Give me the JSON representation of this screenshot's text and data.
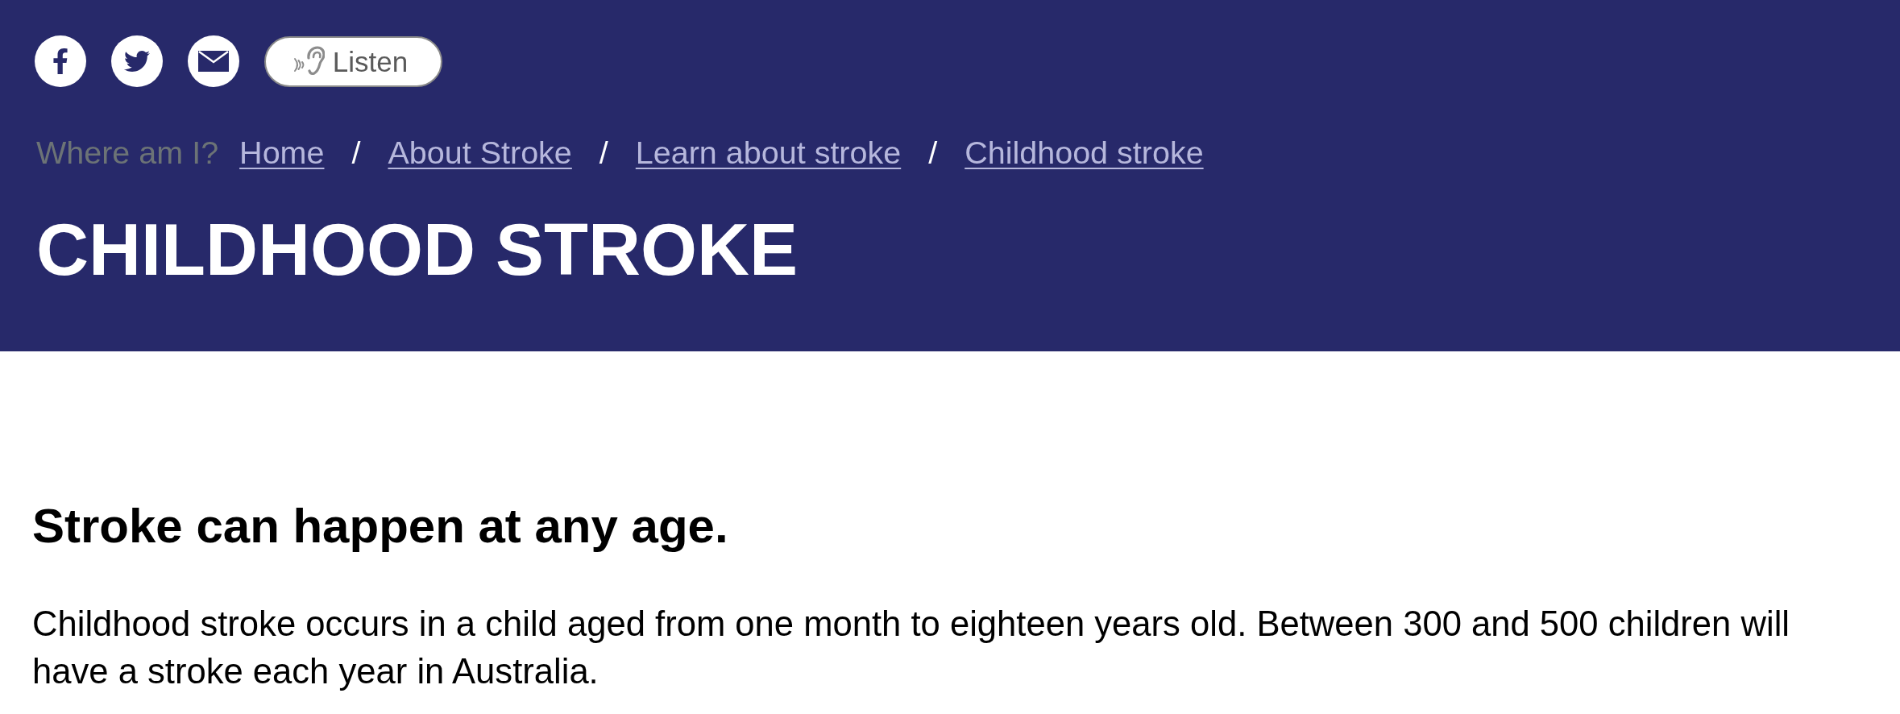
{
  "toolbar": {
    "listen_button": {
      "label": "Listen"
    }
  },
  "breadcrumb": {
    "label": "Where am I?",
    "items": [
      {
        "text": "Home"
      },
      {
        "separator": "/",
        "text": "About Stroke"
      },
      {
        "separator": "/",
        "text": "Learn about stroke"
      },
      {
        "separator": "/",
        "text": "Childhood stroke"
      }
    ]
  },
  "page_title": "CHILDHOOD STROKE",
  "content": {
    "heading": "Stroke can happen at any age.",
    "paragraph": "Childhood stroke occurs in a child aged from one month to eighteen years old. Between 300 and 500 children will have a stroke each year in Australia."
  }
}
